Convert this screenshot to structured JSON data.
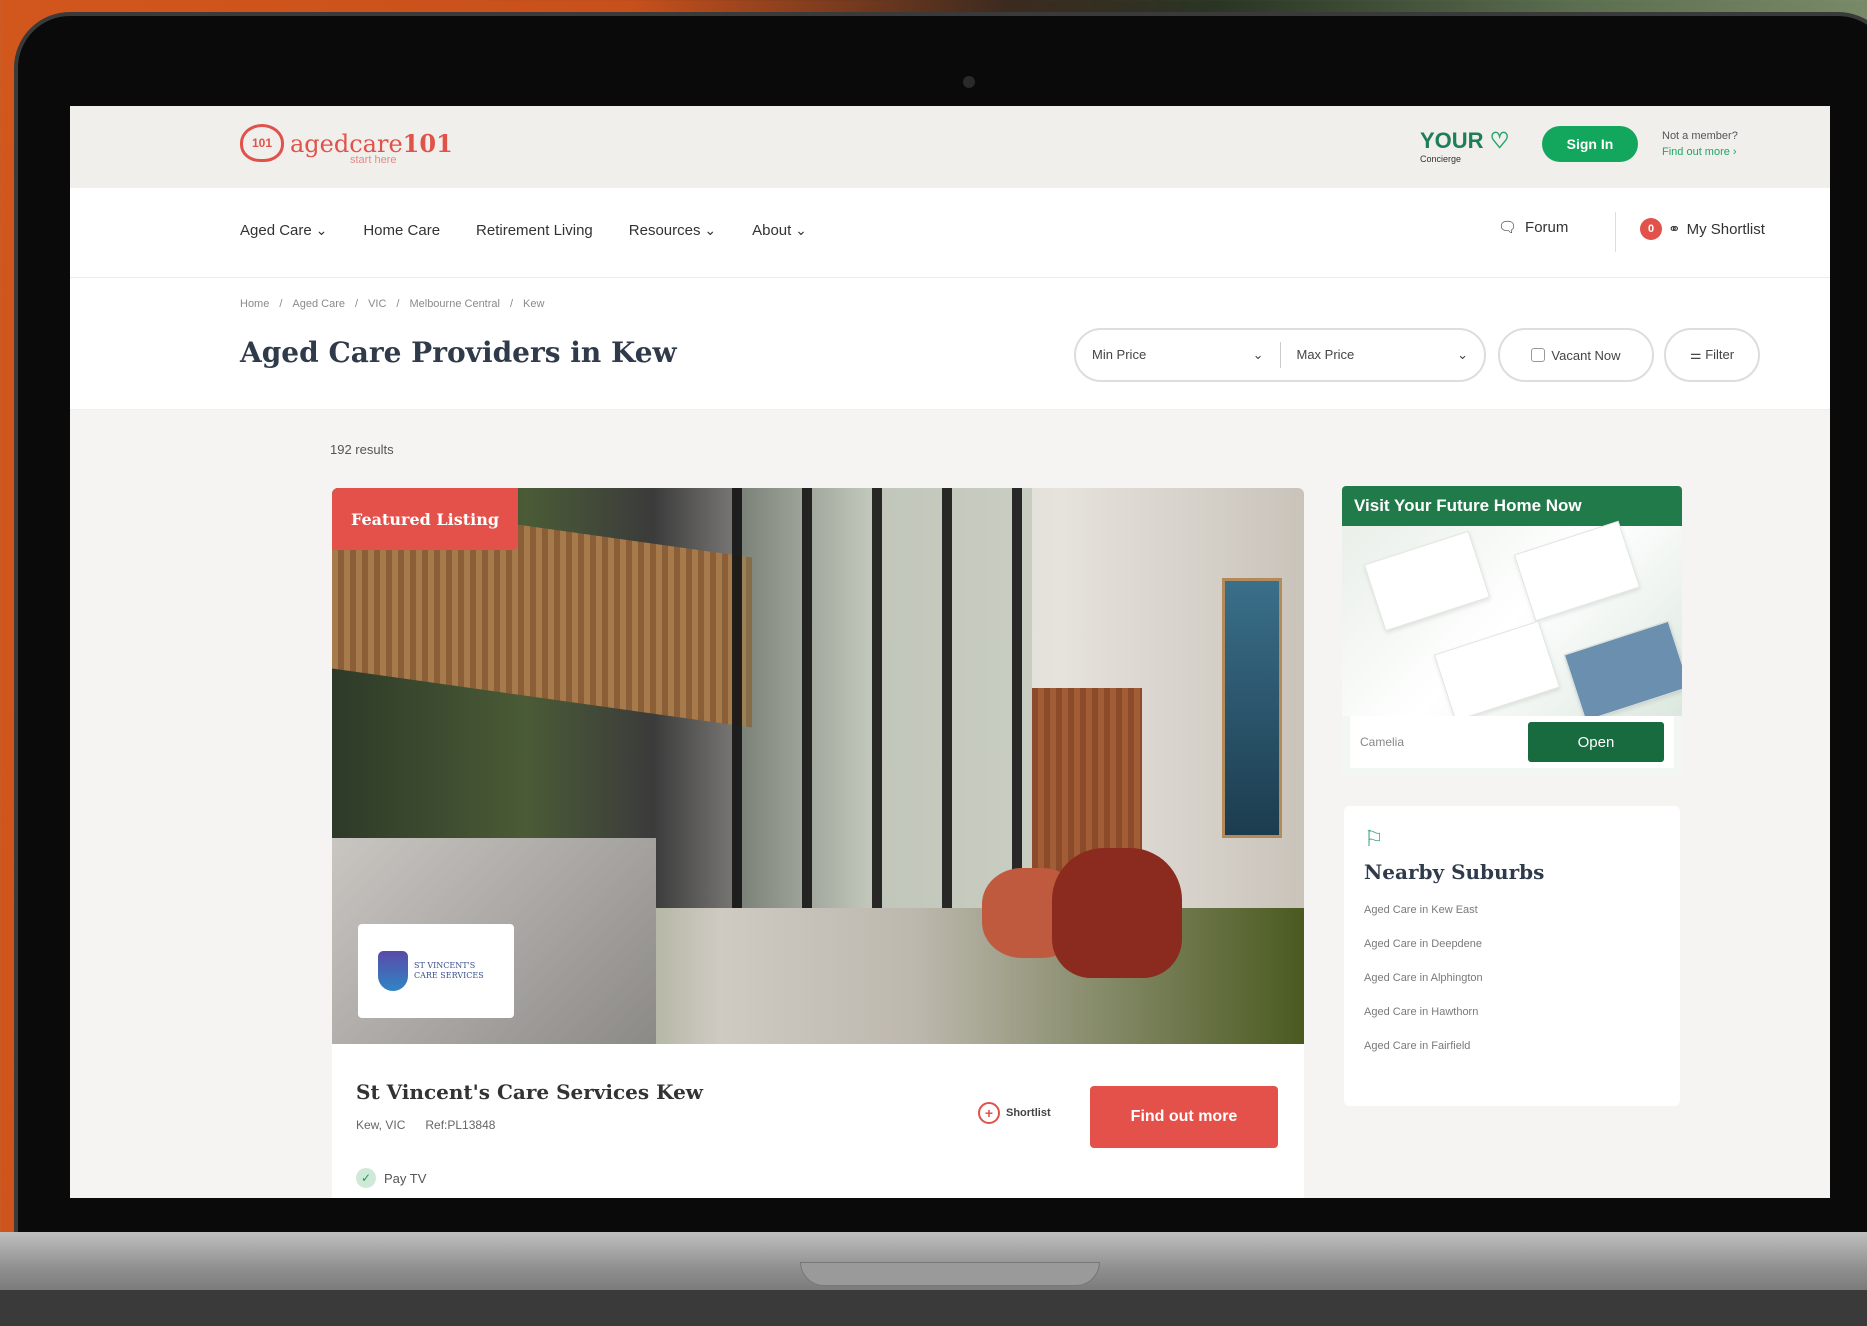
{
  "logo": {
    "brand_light": "agedcare",
    "brand_bold": "101",
    "tagline": "start here",
    "badge": "101"
  },
  "topbar": {
    "concierge_title": "YOUR",
    "concierge_sub": "Concierge",
    "signin_label": "Sign In",
    "member_q": "Not a member?",
    "member_link": "Find out more ›"
  },
  "nav": {
    "items": [
      "Aged Care",
      "Home Care",
      "Retirement Living",
      "Resources",
      "About"
    ],
    "forum": "Forum",
    "shortlist": "My Shortlist",
    "shortlist_count": "0"
  },
  "breadcrumb": [
    "Home",
    "Aged Care",
    "VIC",
    "Melbourne Central",
    "Kew"
  ],
  "page_title": "Aged Care Providers in Kew",
  "filters": {
    "min_price": "Min Price",
    "max_price": "Max Price",
    "vacant": "Vacant Now",
    "filter": "Filter"
  },
  "results_count": "192 results",
  "listing": {
    "badge": "Featured Listing",
    "logo_text": "ST VINCENT'S CARE SERVICES",
    "title": "St Vincent's Care Services Kew",
    "location": "Kew, VIC",
    "ref": "Ref:PL13848",
    "shortlist": "Shortlist",
    "cta": "Find out more",
    "feature": "Pay TV"
  },
  "ad": {
    "title": "Visit Your Future Home Now",
    "brand": "Camelia",
    "cta": "Open"
  },
  "nearby": {
    "title": "Nearby Suburbs",
    "links": [
      "Aged Care in Kew East",
      "Aged Care in Deepdene",
      "Aged Care in Alphington",
      "Aged Care in Hawthorn",
      "Aged Care in Fairfield"
    ]
  },
  "colors": {
    "brand_red": "#e4514a",
    "brand_green": "#13a65d",
    "title_navy": "#2f3a4a"
  }
}
